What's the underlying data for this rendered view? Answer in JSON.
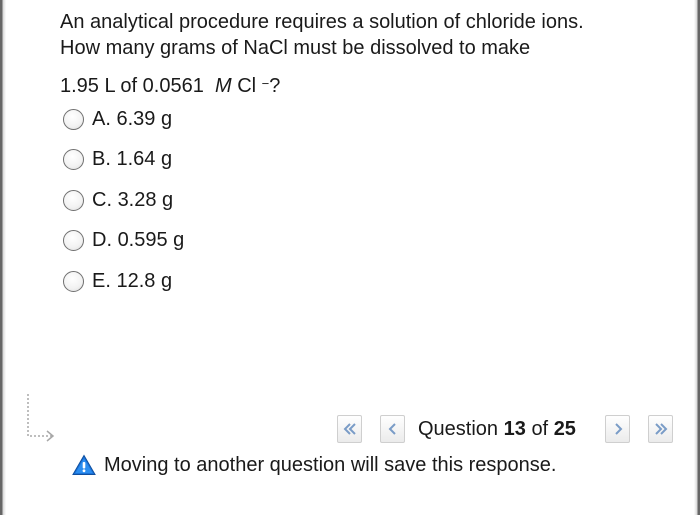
{
  "question": {
    "line1": "An analytical procedure requires a solution of chloride ions.",
    "line2": "How many grams of NaCl must be dissolved to make",
    "formula_prefix": "1.95 L of 0.0561",
    "formula_unit": "M",
    "formula_ion": "Cl",
    "formula_charge": "−",
    "formula_suffix": "?"
  },
  "options": [
    {
      "letter": "A.",
      "text": "6.39 g"
    },
    {
      "letter": "B.",
      "text": "1.64 g"
    },
    {
      "letter": "C.",
      "text": "3.28 g"
    },
    {
      "letter": "D.",
      "text": "0.595 g"
    },
    {
      "letter": "E.",
      "text": "12.8 g"
    }
  ],
  "nav": {
    "question_word": "Question",
    "current": "13",
    "of_word": "of",
    "total": "25"
  },
  "warning": {
    "text": "Moving to another question will save this response."
  },
  "colors": {
    "warning_blue": "#1a73d9",
    "nav_chevron": "#7a9cc7",
    "radio_border": "#707070"
  },
  "icons": [
    "return-arrow-icon",
    "first-page-icon",
    "prev-page-icon",
    "next-page-icon",
    "last-page-icon",
    "warning-icon"
  ]
}
